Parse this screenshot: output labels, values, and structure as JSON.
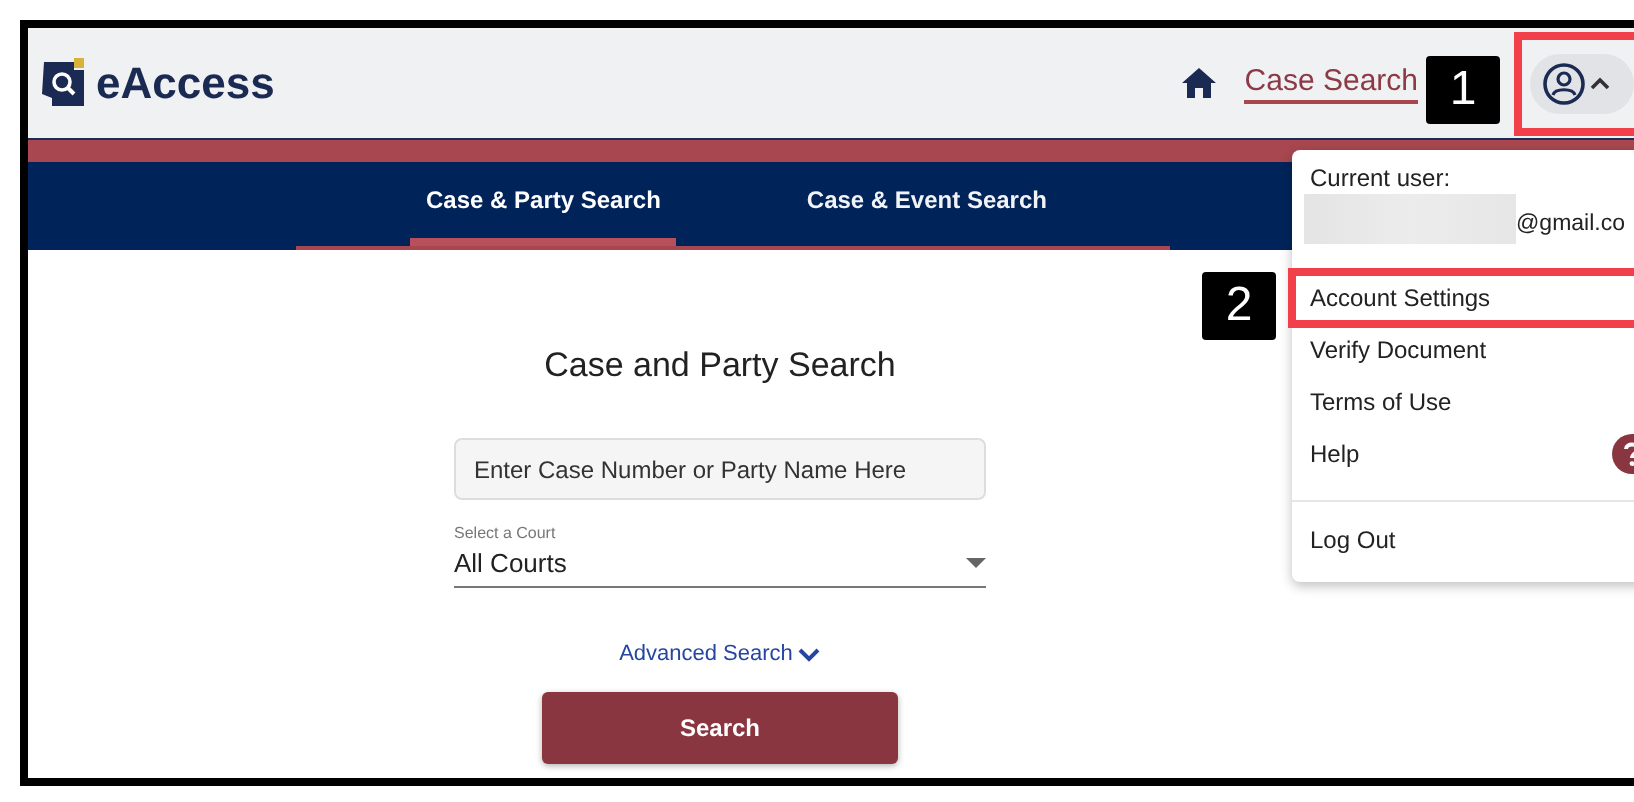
{
  "header": {
    "logo_text": "eAccess",
    "nav_link": "Case Search"
  },
  "tabs": [
    {
      "label": "Case & Party Search",
      "selected": true
    },
    {
      "label": "Case & Event Search",
      "selected": false
    }
  ],
  "search_panel": {
    "title": "Case and Party Search",
    "search_field": {
      "placeholder": "Enter Case Number or Party Name Here"
    },
    "court_select": {
      "label": "Select a Court",
      "value": "All Courts"
    },
    "advanced_link": "Advanced Search",
    "search_button": "Search"
  },
  "user_menu": {
    "expanded": true,
    "highlighted": true,
    "current_user_label": "Current user:",
    "email_suffix": "@gmail.co",
    "items": [
      {
        "label": "Account Settings",
        "kind": "plain",
        "highlighted": true
      },
      {
        "label": "Verify Document",
        "kind": "plain",
        "highlighted": false
      },
      {
        "label": "Terms of Use",
        "kind": "plain",
        "highlighted": false
      },
      {
        "label": "Help",
        "kind": "help",
        "highlighted": false
      }
    ],
    "footer_item": "Log Out"
  },
  "annotations": [
    {
      "label": "1"
    },
    {
      "label": "2"
    }
  ]
}
